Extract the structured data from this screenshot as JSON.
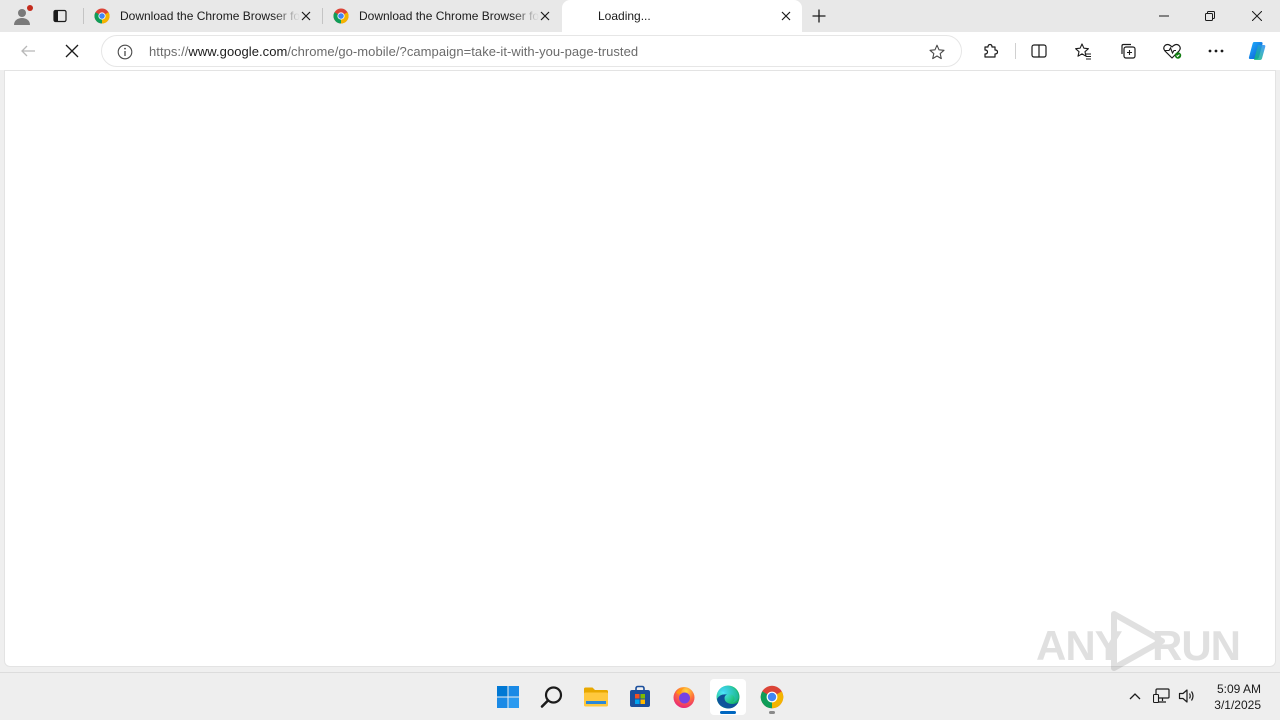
{
  "browser": {
    "tabs": [
      {
        "title": "Download the Chrome Browser for Your Mobile Device",
        "favicon": "chrome-icon",
        "active": false
      },
      {
        "title": "Download the Chrome Browser for Your Mobile Device",
        "favicon": "chrome-icon",
        "active": false
      },
      {
        "title": "Loading...",
        "favicon": "none",
        "active": true
      }
    ],
    "address": {
      "scheme": "https://",
      "host": "www.google.com",
      "path": "/chrome/go-mobile/?campaign=take-it-with-you-page-trusted"
    },
    "page_state": "loading",
    "accent_color": "#0067c0"
  },
  "watermark": {
    "left": "ANY",
    "right": "RUN"
  },
  "taskbar": {
    "pinned": [
      "windows-start-icon",
      "search-icon",
      "file-explorer-icon",
      "microsoft-store-icon",
      "firefox-icon",
      "edge-icon",
      "chrome-icon"
    ],
    "active_app": "edge-icon",
    "clock": {
      "time": "5:09 AM",
      "date": "3/1/2025"
    }
  }
}
